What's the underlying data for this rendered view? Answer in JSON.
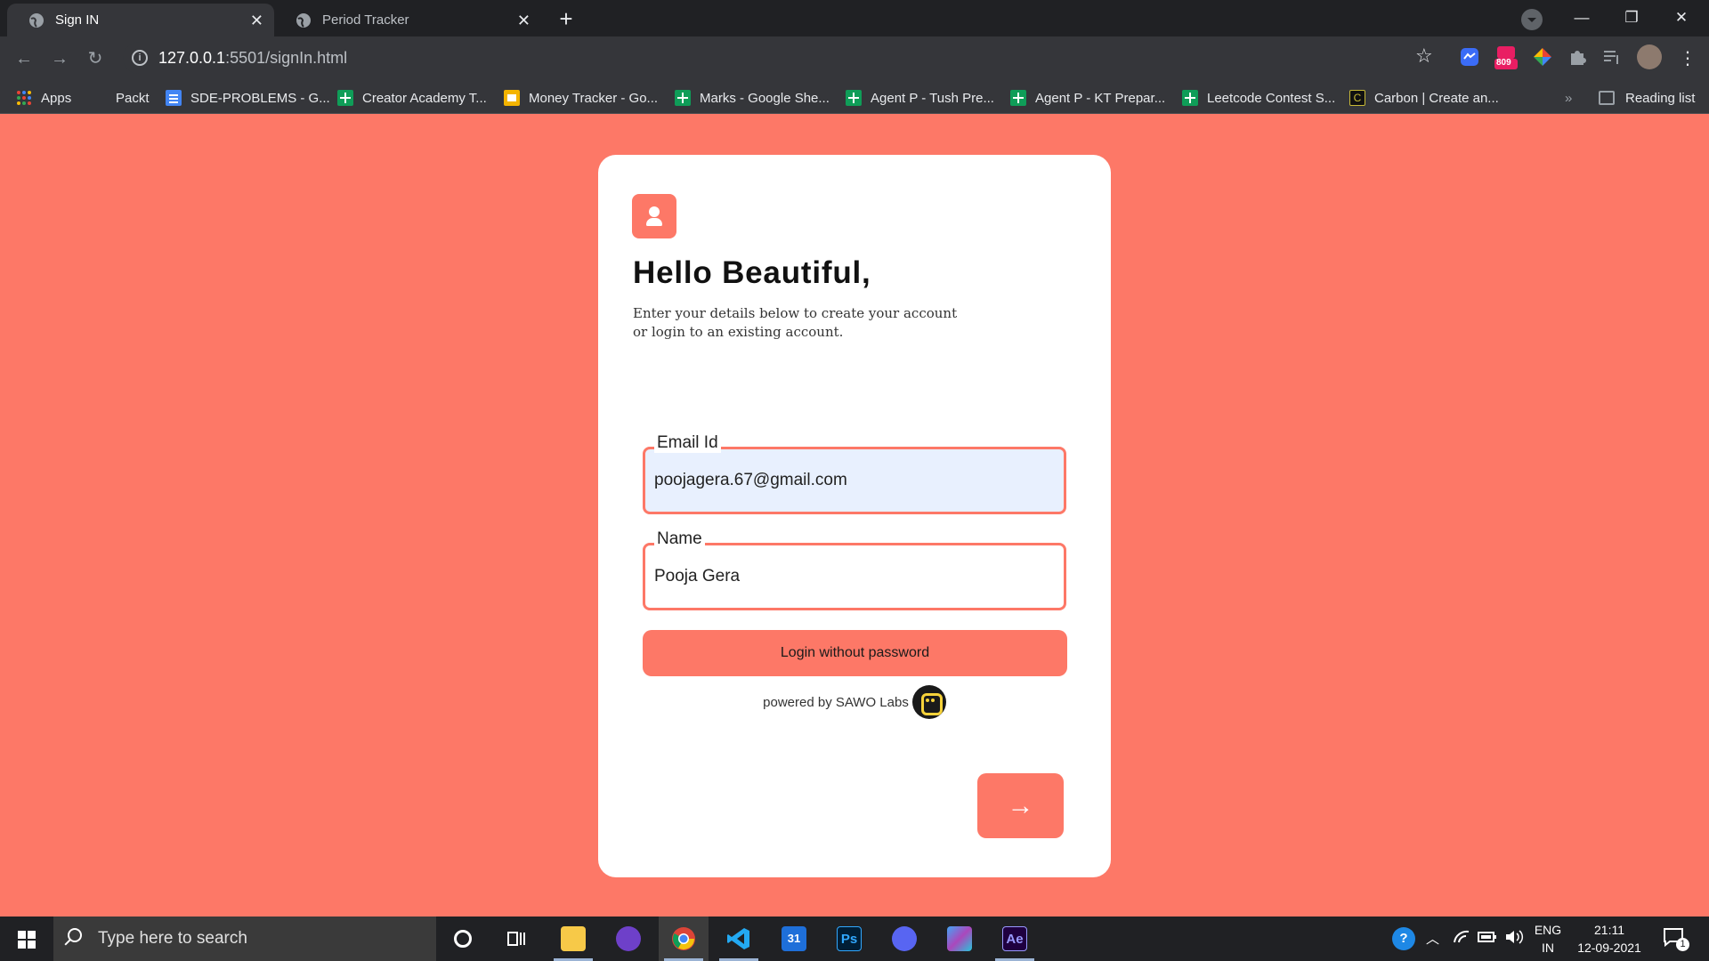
{
  "browser": {
    "tabs": [
      {
        "title": "Sign IN",
        "active": true
      },
      {
        "title": "Period Tracker",
        "active": false
      }
    ],
    "url": {
      "host": "127.0.0.1",
      "path": ":5501/signIn.html"
    },
    "extensions": {
      "badge_count": "809"
    },
    "bookmarks": [
      {
        "label": "Apps",
        "icon": "apps-grid-icon"
      },
      {
        "label": "Packt",
        "icon": "none"
      },
      {
        "label": "SDE-PROBLEMS - G...",
        "icon": "google-docs-icon"
      },
      {
        "label": "Creator Academy T...",
        "icon": "google-sheets-icon"
      },
      {
        "label": "Money Tracker - Go...",
        "icon": "google-slides-icon"
      },
      {
        "label": "Marks - Google She...",
        "icon": "google-sheets-icon"
      },
      {
        "label": "Agent P - Tush Pre...",
        "icon": "google-sheets-icon"
      },
      {
        "label": "Agent P - KT Prepar...",
        "icon": "google-sheets-icon"
      },
      {
        "label": "Leetcode Contest S...",
        "icon": "google-sheets-icon"
      },
      {
        "label": "Carbon | Create an...",
        "icon": "carbon-icon"
      }
    ],
    "overflow_chevron": "»",
    "reading_list": "Reading list"
  },
  "page": {
    "greeting": "Hello Beautiful,",
    "subtitle_line1": "Enter your details below to create your account",
    "subtitle_line2": "or login to an existing account.",
    "email": {
      "label": "Email Id",
      "value": "poojagera.67@gmail.com"
    },
    "name": {
      "label": "Name",
      "value": "Pooja Gera"
    },
    "login_button": "Login without password",
    "powered_by": "powered by SAWO Labs",
    "next_button": "→",
    "colors": {
      "accent": "#fd7867",
      "card": "#ffffff",
      "autofill": "#e8f0fe"
    }
  },
  "taskbar": {
    "search_placeholder": "Type here to search",
    "apps": [
      "file-explorer-icon",
      "github-desktop-icon",
      "chrome-icon",
      "vscode-icon",
      "calendar-icon",
      "photoshop-icon",
      "discord-icon",
      "app-icon",
      "after-effects-icon"
    ],
    "calendar_day": "31",
    "photoshop_label": "Ps",
    "aftereffects_label": "Ae",
    "lang_line1": "ENG",
    "lang_line2": "IN",
    "time": "21:11",
    "date": "12-09-2021",
    "notification_count": "1"
  }
}
